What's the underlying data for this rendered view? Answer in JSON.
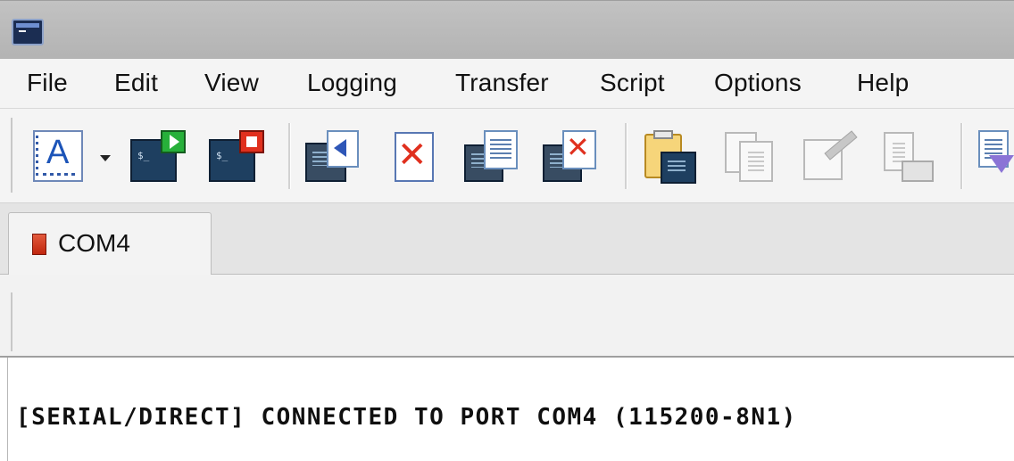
{
  "window": {
    "icon": "terminal-app-icon"
  },
  "menu": [
    "File",
    "Edit",
    "View",
    "Logging",
    "Transfer",
    "Script",
    "Options",
    "Help"
  ],
  "toolbar": {
    "buttons": [
      {
        "name": "font-icon",
        "enabled": true
      },
      {
        "name": "dropdown-arrow-icon",
        "enabled": true
      },
      {
        "name": "connect-icon",
        "enabled": true
      },
      {
        "name": "disconnect-icon",
        "enabled": true
      },
      {
        "name": "reconnect-icon",
        "enabled": true
      },
      {
        "name": "cancel-icon",
        "enabled": true
      },
      {
        "name": "session-options-icon",
        "enabled": true
      },
      {
        "name": "disconnect-all-icon",
        "enabled": true
      },
      {
        "name": "paste-screen-icon",
        "enabled": true
      },
      {
        "name": "copy-icon",
        "enabled": false
      },
      {
        "name": "edit-icon",
        "enabled": false
      },
      {
        "name": "print-icon",
        "enabled": false
      },
      {
        "name": "send-file-icon",
        "enabled": true
      }
    ]
  },
  "tabs": [
    {
      "label": "COM4",
      "status_color": "#d03a1f"
    }
  ],
  "terminal": {
    "lines": [
      "[SERIAL/DIRECT] CONNECTED TO PORT COM4 (115200-8N1)"
    ]
  },
  "colors": {
    "accent": "#1e3f60",
    "play": "#27b03a",
    "stop": "#e0301e",
    "disconnected": "#d03a1f"
  }
}
